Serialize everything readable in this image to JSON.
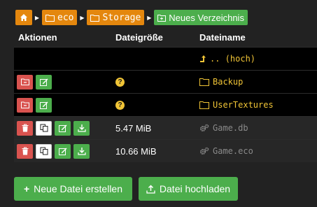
{
  "breadcrumb": {
    "items": [
      {
        "label": "",
        "icon": "home-icon"
      },
      {
        "label": "eco",
        "icon": "folder-icon"
      },
      {
        "label": "Storage",
        "icon": "folder-icon"
      },
      {
        "label": "Neues Verzeichnis",
        "icon": "new-folder-icon"
      }
    ],
    "separator_icon": "caret-right-icon"
  },
  "table": {
    "headers": {
      "actions": "Aktionen",
      "size": "Dateigröße",
      "name": "Dateiname"
    },
    "rows": [
      {
        "name": ".. (hoch)",
        "size": "",
        "type": "parent"
      },
      {
        "name": "Backup",
        "size": "?",
        "type": "folder"
      },
      {
        "name": "UserTextures",
        "size": "?",
        "type": "folder"
      },
      {
        "name": "Game.db",
        "size": "5.47 MiB",
        "type": "file"
      },
      {
        "name": "Game.eco",
        "size": "10.66 MiB",
        "type": "file"
      }
    ]
  },
  "buttons": {
    "new_file": "Neue Datei erstellen",
    "upload": "Datei hochladen"
  },
  "colors": {
    "orange": "#e4870e",
    "green": "#4cae4c",
    "red": "#d9534f",
    "yellow": "#f0c436",
    "background": "#222222"
  }
}
